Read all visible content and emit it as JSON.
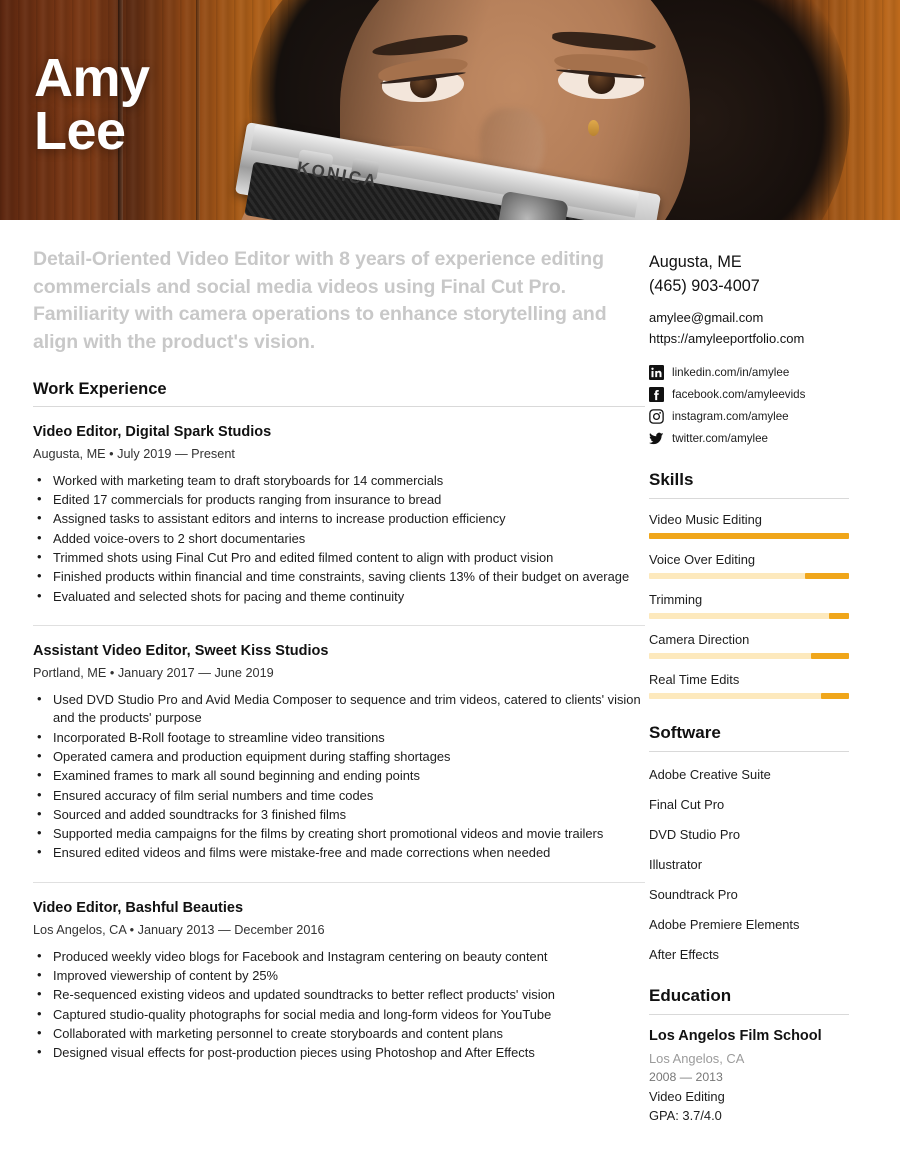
{
  "header": {
    "first_name": "Amy",
    "last_name": "Lee",
    "camera_brand": "KONICA"
  },
  "summary": "Detail-Oriented Video Editor with 8 years of experience editing commercials and social media videos using Final Cut Pro. Familiarity with camera operations to enhance storytelling and align with the product's vision.",
  "work": {
    "section_title": "Work Experience",
    "jobs": [
      {
        "title": "Video Editor, Digital Spark Studios",
        "meta": "Augusta, ME • July 2019 — Present",
        "bullets": [
          "Worked with marketing team to draft storyboards for 14 commercials",
          "Edited 17 commercials for products ranging from insurance to bread",
          "Assigned tasks to assistant editors and interns to increase production efficiency",
          "Added voice-overs to 2 short documentaries",
          "Trimmed shots using Final Cut Pro and edited filmed content to align with product vision",
          "Finished products within financial and time constraints, saving clients 13% of their budget on average",
          "Evaluated and selected shots for pacing and theme continuity"
        ]
      },
      {
        "title": "Assistant Video Editor, Sweet Kiss Studios",
        "meta": "Portland, ME • January 2017 — June 2019",
        "bullets": [
          "Used DVD Studio Pro and Avid Media Composer to sequence and trim videos, catered to clients' vision and the products' purpose",
          "Incorporated B-Roll footage to streamline video transitions",
          "Operated camera and production equipment during staffing shortages",
          "Examined frames to mark all sound beginning and ending points",
          "Ensured accuracy of film serial numbers and time codes",
          "Sourced and added soundtracks for 3 finished films",
          "Supported media campaigns for the films by creating short promotional videos and movie trailers",
          "Ensured edited videos and films were mistake-free and made corrections when needed"
        ]
      },
      {
        "title": "Video Editor, Bashful Beauties",
        "meta": "Los Angelos, CA • January 2013 — December 2016",
        "bullets": [
          "Produced weekly video blogs for Facebook and Instagram centering on beauty content",
          "Improved viewership of content by 25%",
          "Re-sequenced existing videos and updated soundtracks to better reflect products' vision",
          "Captured studio-quality photographs for social media and long-form videos for YouTube",
          "Collaborated with marketing personnel to create storyboards and content plans",
          "Designed visual effects for post-production pieces using Photoshop and After Effects"
        ]
      }
    ]
  },
  "contact": {
    "location": "Augusta, ME",
    "phone": "(465) 903-4007",
    "email": "amylee@gmail.com",
    "website": "https://amyleeportfolio.com",
    "social": [
      {
        "icon": "linkedin-icon",
        "label": "linkedin.com/in/amylee"
      },
      {
        "icon": "facebook-icon",
        "label": "facebook.com/amyleevids"
      },
      {
        "icon": "instagram-icon",
        "label": "instagram.com/amylee"
      },
      {
        "icon": "twitter-icon",
        "label": "twitter.com/amylee"
      }
    ]
  },
  "skills": {
    "section_title": "Skills",
    "items": [
      {
        "label": "Video Music Editing",
        "level": 100
      },
      {
        "label": "Voice Over Editing",
        "level": 22
      },
      {
        "label": "Trimming",
        "level": 10
      },
      {
        "label": "Camera Direction",
        "level": 19
      },
      {
        "label": "Real Time Edits",
        "level": 14
      }
    ]
  },
  "software": {
    "section_title": "Software",
    "items": [
      "Adobe Creative Suite",
      "Final Cut Pro",
      "DVD Studio Pro",
      "Illustrator",
      "Soundtrack Pro",
      "Adobe Premiere Elements",
      "After Effects"
    ]
  },
  "education": {
    "section_title": "Education",
    "school": "Los Angelos Film School",
    "location": "Los Angelos, CA",
    "years": "2008 — 2013",
    "field": "Video Editing",
    "gpa": "GPA: 3.7/4.0"
  },
  "colors": {
    "accent_orange": "#f0a61a",
    "track_yellow": "#fde9bd",
    "banner_wood": "#6b2c10"
  }
}
